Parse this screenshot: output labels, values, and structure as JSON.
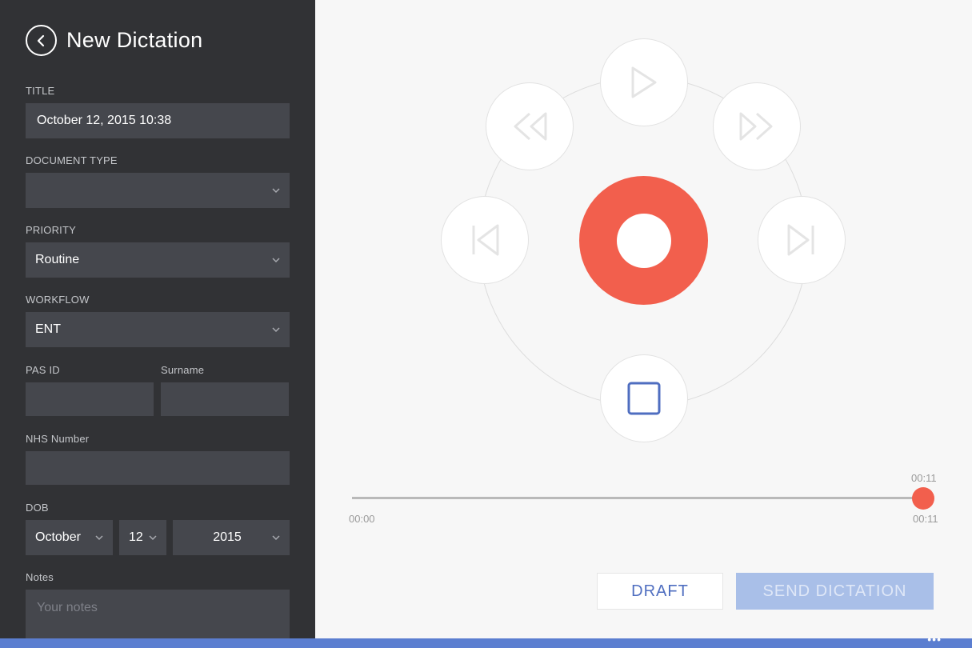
{
  "header": {
    "title": "New Dictation"
  },
  "form": {
    "title_label": "TITLE",
    "title_value": "October 12, 2015 10:38",
    "doctype_label": "DOCUMENT TYPE",
    "doctype_value": "",
    "priority_label": "PRIORITY",
    "priority_value": "Routine",
    "workflow_label": "WORKFLOW",
    "workflow_value": "ENT",
    "pas_label": "PAS ID",
    "pas_value": "",
    "surname_label": "Surname",
    "surname_value": "",
    "nhs_label": "NHS Number",
    "nhs_value": "",
    "dob_label": "DOB",
    "dob_month": "October",
    "dob_day": "12",
    "dob_year": "2015",
    "notes_label": "Notes",
    "notes_placeholder": "Your notes"
  },
  "player": {
    "controls": [
      "play-icon",
      "rewind-icon",
      "fast-forward-icon",
      "skip-back-icon",
      "skip-forward-icon",
      "stop-icon"
    ],
    "record_color": "#f25f4d",
    "stop_color": "#4f6ec0",
    "progress": 1.0,
    "time_current": "00:11",
    "time_start": "00:00",
    "time_end": "00:11"
  },
  "actions": {
    "draft_label": "DRAFT",
    "send_label": "SEND DICTATION"
  },
  "colors": {
    "sidebar": "#313235",
    "field": "#45474d",
    "accent": "#5b7ed0"
  }
}
